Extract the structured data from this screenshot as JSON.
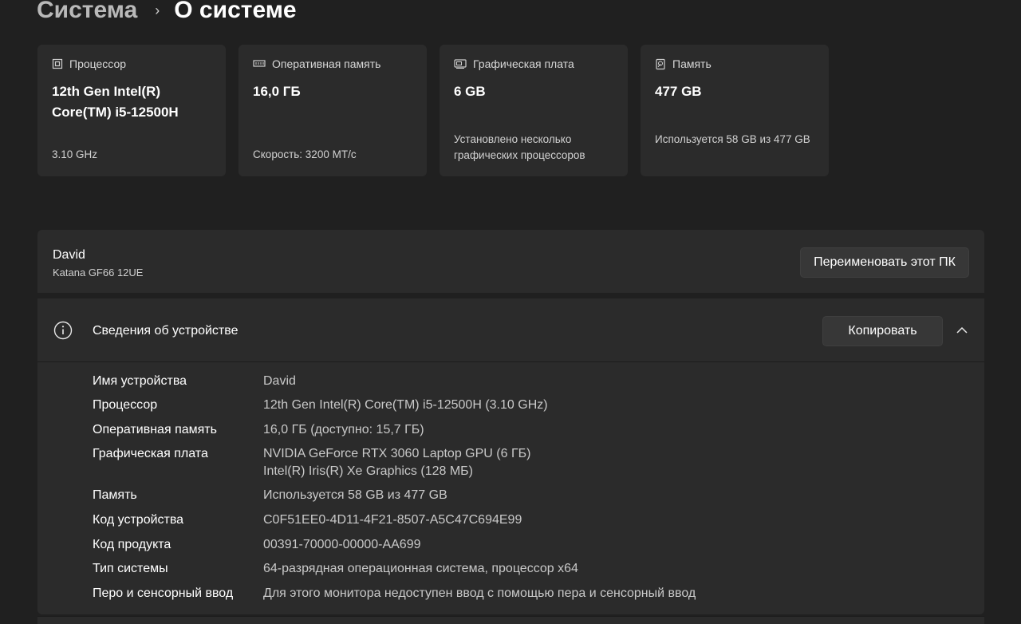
{
  "breadcrumb": {
    "parent": "Система",
    "separator": "›",
    "current": "О системе"
  },
  "cards": [
    {
      "icon": "processor-icon",
      "label": "Процессор",
      "value": "12th Gen Intel(R) Core(TM) i5-12500H",
      "sub": "3.10 GHz"
    },
    {
      "icon": "ram-icon",
      "label": "Оперативная память",
      "value": "16,0 ГБ",
      "sub": "Скорость: 3200 MT/с"
    },
    {
      "icon": "gpu-icon",
      "label": "Графическая плата",
      "value": "6 GB",
      "sub": "Установлено несколько графических процессоров"
    },
    {
      "icon": "storage-icon",
      "label": "Память",
      "value": "477 GB",
      "sub": "Используется 58 GB из 477 GB"
    }
  ],
  "device": {
    "name": "David",
    "model": "Katana GF66 12UE",
    "rename_label": "Переименовать этот ПК"
  },
  "info": {
    "title": "Сведения об устройстве",
    "copy_label": "Копировать",
    "rows": [
      {
        "label": "Имя устройства",
        "value": "David"
      },
      {
        "label": "Процессор",
        "value": "12th Gen Intel(R) Core(TM) i5-12500H (3.10 GHz)"
      },
      {
        "label": "Оперативная память",
        "value": "16,0 ГБ (доступно: 15,7 ГБ)"
      },
      {
        "label": "Графическая плата",
        "value": "NVIDIA GeForce RTX 3060 Laptop GPU (6 ГБ)",
        "value2": "Intel(R) Iris(R) Xe Graphics (128 МБ)"
      },
      {
        "label": "Память",
        "value": "Используется 58 GB из 477 GB"
      },
      {
        "label": "Код устройства",
        "value": "C0F51EE0-4D11-4F21-8507-A5C47C694E99"
      },
      {
        "label": "Код продукта",
        "value": "00391-70000-00000-AA699"
      },
      {
        "label": "Тип системы",
        "value": "64-разрядная операционная система, процессор x64"
      },
      {
        "label": "Перо и сенсорный ввод",
        "value": "Для этого монитора недоступен ввод с помощью пера и сенсорный ввод"
      }
    ]
  }
}
